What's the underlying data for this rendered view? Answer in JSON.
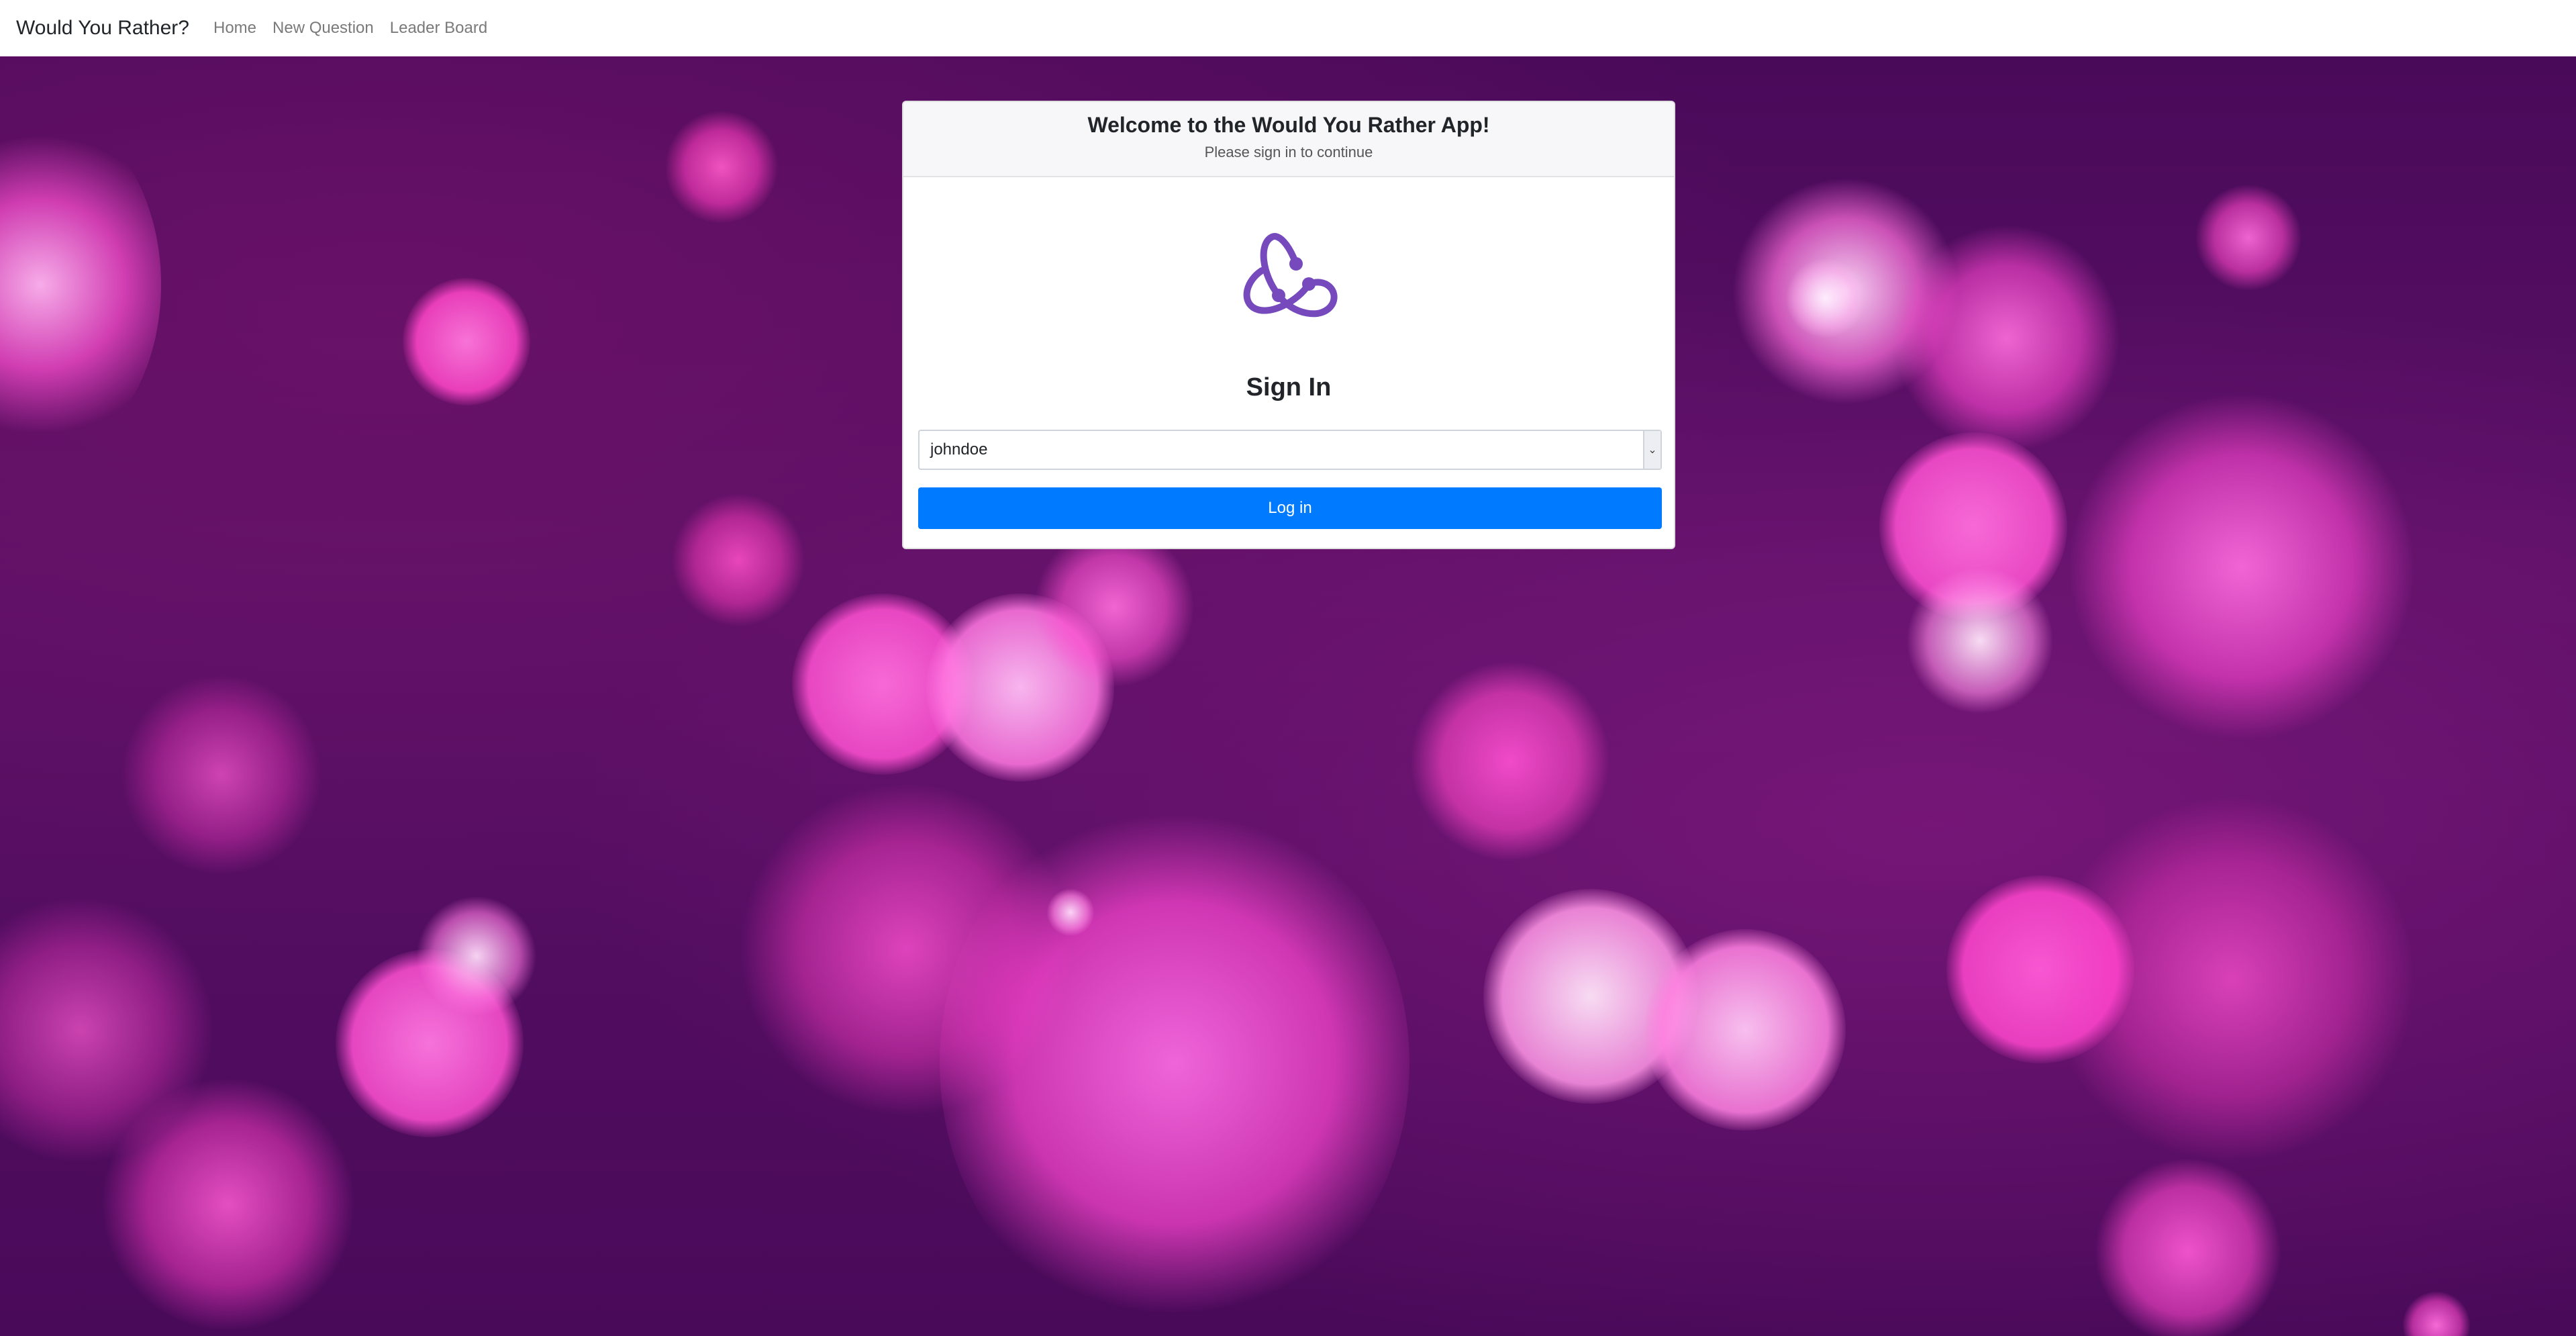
{
  "navbar": {
    "brand": "Would You Rather?",
    "links": [
      {
        "label": "Home"
      },
      {
        "label": "New Question"
      },
      {
        "label": "Leader Board"
      }
    ]
  },
  "card": {
    "title": "Welcome to the Would You Rather App!",
    "subtitle": "Please sign in to continue",
    "logo_icon": "redux-logo-icon",
    "heading": "Sign In",
    "user_select": {
      "selected": "johndoe"
    },
    "login_button": "Log in"
  },
  "colors": {
    "primary_button": "#007bff",
    "logo_purple": "#764abc",
    "background_purple": "#4a0a5a",
    "bokeh_pink": "#ff3fc8"
  }
}
